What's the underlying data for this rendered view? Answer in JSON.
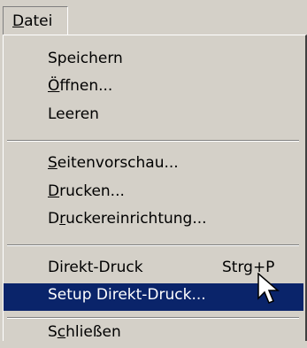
{
  "menubar": {
    "datei": {
      "prefix": "",
      "mnemonic": "D",
      "rest": "atei"
    }
  },
  "menu": {
    "items": [
      {
        "prefix": "",
        "mnemonic": "",
        "rest": "Speichern",
        "shortcut": ""
      },
      {
        "prefix": "",
        "mnemonic": "Ö",
        "rest": "ffnen...",
        "shortcut": ""
      },
      {
        "prefix": "",
        "mnemonic": "",
        "rest": "Leeren",
        "shortcut": ""
      },
      {
        "prefix": "",
        "mnemonic": "S",
        "rest": "eitenvorschau...",
        "shortcut": ""
      },
      {
        "prefix": "",
        "mnemonic": "D",
        "rest": "rucken...",
        "shortcut": ""
      },
      {
        "prefix": "D",
        "mnemonic": "r",
        "rest": "uckereinrichtung...",
        "shortcut": ""
      },
      {
        "prefix": "",
        "mnemonic": "",
        "rest": "Direkt-Druck",
        "shortcut": "Strg+P"
      },
      {
        "prefix": "",
        "mnemonic": "",
        "rest": "Setup Direkt-Druck...",
        "shortcut": ""
      },
      {
        "prefix": "S",
        "mnemonic": "c",
        "rest": "hließen",
        "shortcut": ""
      }
    ]
  },
  "colors": {
    "menu_bg": "#d4d0c8",
    "highlight": "#0a246a",
    "highlight_text": "#ffffff"
  },
  "icons": {
    "cursor": "arrow-cursor-icon"
  }
}
